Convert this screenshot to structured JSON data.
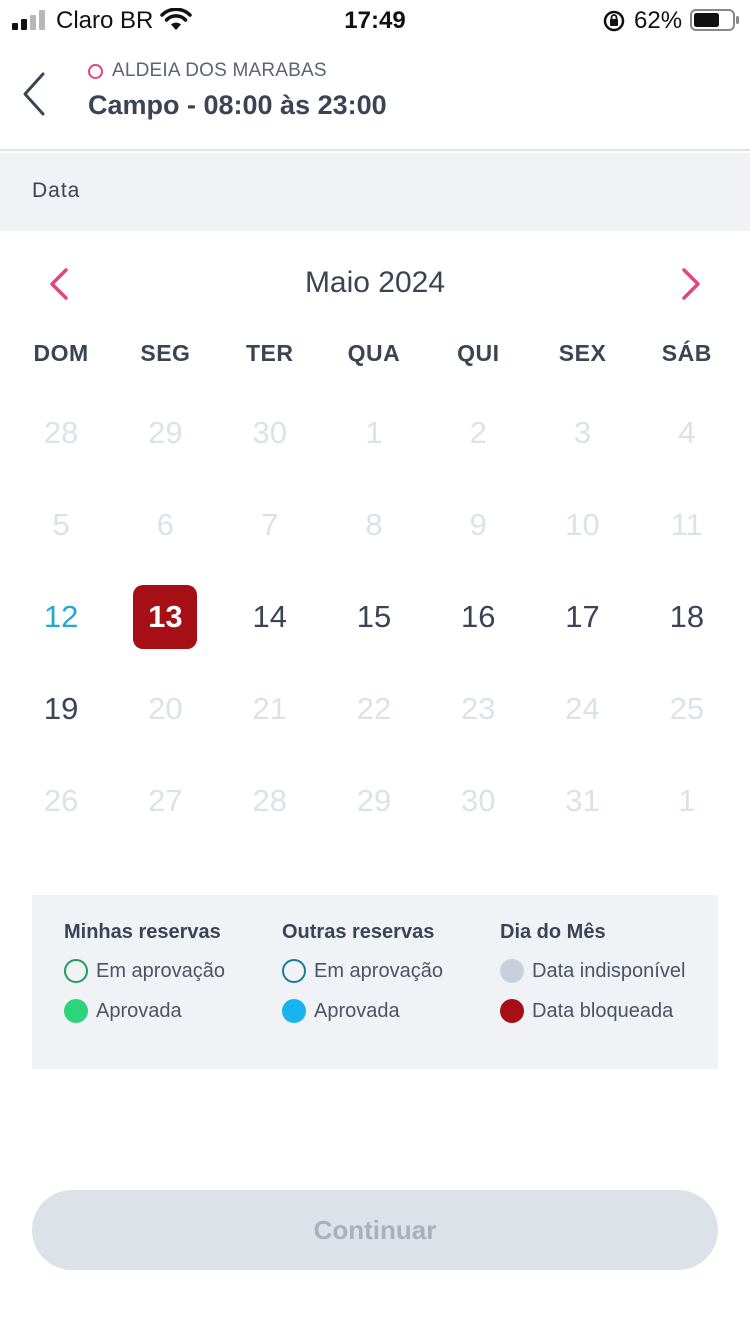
{
  "status_bar": {
    "carrier": "Claro BR",
    "time": "17:49",
    "battery_pct": "62%"
  },
  "header": {
    "venue": "ALDEIA DOS MARABAS",
    "title": "Campo - 08:00 às 23:00",
    "venue_dot_color": "#e0457b"
  },
  "section": {
    "label": "Data"
  },
  "calendar": {
    "month_label": "Maio 2024",
    "nav_color": "#e0457b",
    "weekdays": [
      "DOM",
      "SEG",
      "TER",
      "QUA",
      "QUI",
      "SEX",
      "SÁB"
    ],
    "weeks": [
      [
        {
          "d": "28",
          "s": "muted"
        },
        {
          "d": "29",
          "s": "muted"
        },
        {
          "d": "30",
          "s": "muted"
        },
        {
          "d": "1",
          "s": "muted"
        },
        {
          "d": "2",
          "s": "muted"
        },
        {
          "d": "3",
          "s": "muted"
        },
        {
          "d": "4",
          "s": "muted"
        }
      ],
      [
        {
          "d": "5",
          "s": "muted"
        },
        {
          "d": "6",
          "s": "muted"
        },
        {
          "d": "7",
          "s": "muted"
        },
        {
          "d": "8",
          "s": "muted"
        },
        {
          "d": "9",
          "s": "muted"
        },
        {
          "d": "10",
          "s": "muted"
        },
        {
          "d": "11",
          "s": "muted"
        }
      ],
      [
        {
          "d": "12",
          "s": "today"
        },
        {
          "d": "13",
          "s": "selected"
        },
        {
          "d": "14",
          "s": "active"
        },
        {
          "d": "15",
          "s": "active"
        },
        {
          "d": "16",
          "s": "active"
        },
        {
          "d": "17",
          "s": "active"
        },
        {
          "d": "18",
          "s": "active"
        }
      ],
      [
        {
          "d": "19",
          "s": "active"
        },
        {
          "d": "20",
          "s": "muted"
        },
        {
          "d": "21",
          "s": "muted"
        },
        {
          "d": "22",
          "s": "muted"
        },
        {
          "d": "23",
          "s": "muted"
        },
        {
          "d": "24",
          "s": "muted"
        },
        {
          "d": "25",
          "s": "muted"
        }
      ],
      [
        {
          "d": "26",
          "s": "muted"
        },
        {
          "d": "27",
          "s": "muted"
        },
        {
          "d": "28",
          "s": "muted"
        },
        {
          "d": "29",
          "s": "muted"
        },
        {
          "d": "30",
          "s": "muted"
        },
        {
          "d": "31",
          "s": "muted"
        },
        {
          "d": "1",
          "s": "muted"
        }
      ]
    ]
  },
  "legend": {
    "mine": {
      "title": "Minhas reservas",
      "pending": "Em aprovação",
      "approved": "Aprovada",
      "color": "#1f9e5a",
      "fill": "#2ed47a"
    },
    "others": {
      "title": "Outras reservas",
      "pending": "Em aprovação",
      "approved": "Aprovada",
      "color": "#1a7a99",
      "fill": "#17b4ef"
    },
    "month": {
      "title": "Dia do Mês",
      "unavailable": "Data indisponível",
      "blocked": "Data bloqueada",
      "unavailable_color": "#c9cfdb",
      "blocked_color": "#a50f15"
    }
  },
  "footer": {
    "continue_label": "Continuar"
  }
}
